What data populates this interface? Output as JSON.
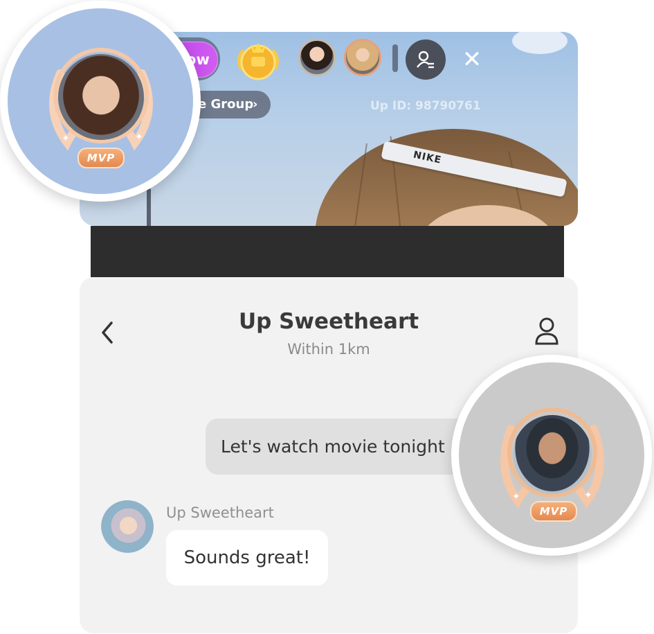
{
  "stream": {
    "follow_label": "+Follow",
    "love_group_label": "True Love Group",
    "love_group_chevron": "›",
    "id_text": "Up ID: 98790761",
    "headband_text": "NIKE",
    "close_label": "✕"
  },
  "chat": {
    "title": "Up Sweetheart",
    "subtitle": "Within 1km",
    "messages": [
      {
        "direction": "outgoing",
        "text": "Let's watch movie tonight"
      },
      {
        "direction": "incoming",
        "sender": "Up Sweetheart",
        "text": "Sounds great!"
      }
    ]
  },
  "badges": {
    "left_mvp": "MVP",
    "right_mvp": "MVP"
  },
  "colors": {
    "follow_gradient_start": "#b33ae8",
    "follow_gradient_end": "#d25cf2",
    "mvp_badge": "#e48950",
    "love_heart": "#ff5a6e"
  }
}
